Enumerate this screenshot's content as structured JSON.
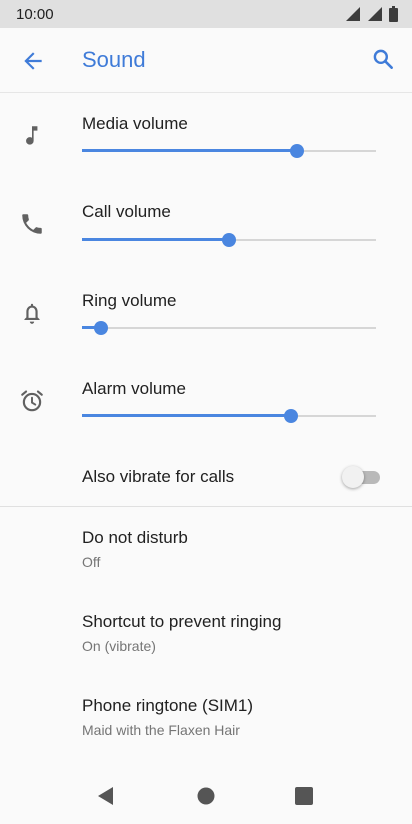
{
  "status_bar": {
    "time": "10:00"
  },
  "app_bar": {
    "title": "Sound"
  },
  "sliders": [
    {
      "label": "Media volume",
      "icon": "music-note-icon",
      "level": 0.73
    },
    {
      "label": "Call volume",
      "icon": "phone-icon",
      "level": 0.5
    },
    {
      "label": "Ring volume",
      "icon": "bell-icon",
      "level": 0.065
    },
    {
      "label": "Alarm volume",
      "icon": "alarm-clock-icon",
      "level": 0.71
    }
  ],
  "vibrate": {
    "label": "Also vibrate for calls",
    "enabled": false
  },
  "prefs": [
    {
      "title": "Do not disturb",
      "summary": "Off"
    },
    {
      "title": "Shortcut to prevent ringing",
      "summary": "On (vibrate)"
    },
    {
      "title": "Phone ringtone (SIM1)",
      "summary": "Maid with the Flaxen Hair"
    }
  ],
  "colors": {
    "accent": "#4a86e0",
    "title": "#3f7bd8",
    "icon": "#616161",
    "status_bar": "#e0e0e0"
  }
}
